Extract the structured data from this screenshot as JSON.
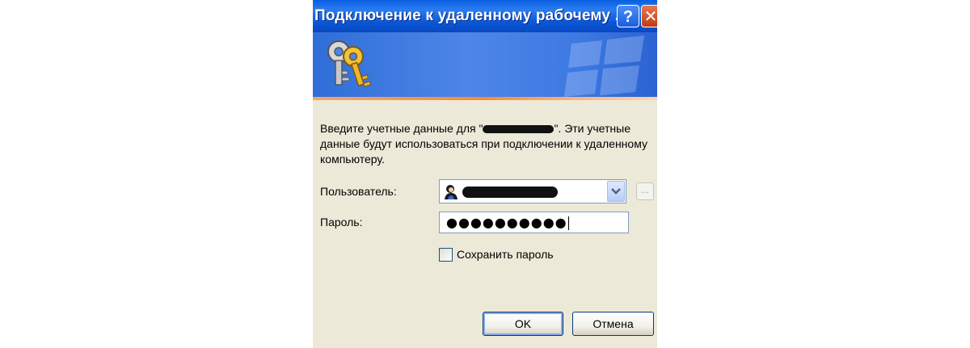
{
  "window": {
    "title": "Подключение к удаленному рабочему ...",
    "help_label": "?",
    "close_label": "✕"
  },
  "banner": {
    "icon": "keys-icon",
    "watermark": "windows-logo-icon"
  },
  "description": {
    "before": "Введите учетные данные для \"",
    "after": "\". Эти учетные данные будут использоваться при подключении к удаленному компьютеру."
  },
  "form": {
    "user_label": "Пользователь:",
    "password_label": "Пароль:",
    "password_value": "●●●●●●●●●●",
    "browse_label": "...",
    "save_password_label": "Сохранить пароль",
    "save_password_checked": false
  },
  "buttons": {
    "ok": "OK",
    "cancel": "Отмена"
  },
  "colors": {
    "titlebar": "#0a56d8",
    "dialog_bg": "#ece9d8",
    "banner_accent": "#f78a3a"
  }
}
